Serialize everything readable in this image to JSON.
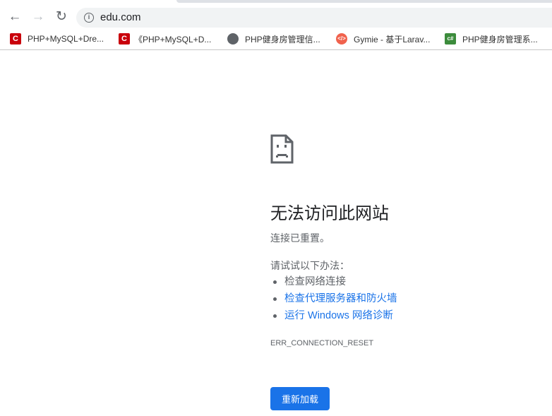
{
  "browser": {
    "url": "edu.com",
    "bookmarks": [
      {
        "label": "PHP+MySQL+Dre...",
        "icon": "csdn-icon"
      },
      {
        "label": "《PHP+MySQL+D...",
        "icon": "csdn-icon"
      },
      {
        "label": "PHP健身房管理信...",
        "icon": "globe-icon"
      },
      {
        "label": "Gymie - 基于Larav...",
        "icon": "code-icon"
      },
      {
        "label": "PHP健身房管理系...",
        "icon": "csharp-icon"
      }
    ]
  },
  "error": {
    "title": "无法访问此网站",
    "subtitle": "连接已重置。",
    "try_label": "请试试以下办法：",
    "suggestions": [
      "检查网络连接",
      "检查代理服务器和防火墙",
      "运行 Windows 网络诊断"
    ],
    "code": "ERR_CONNECTION_RESET",
    "reload_label": "重新加载"
  }
}
